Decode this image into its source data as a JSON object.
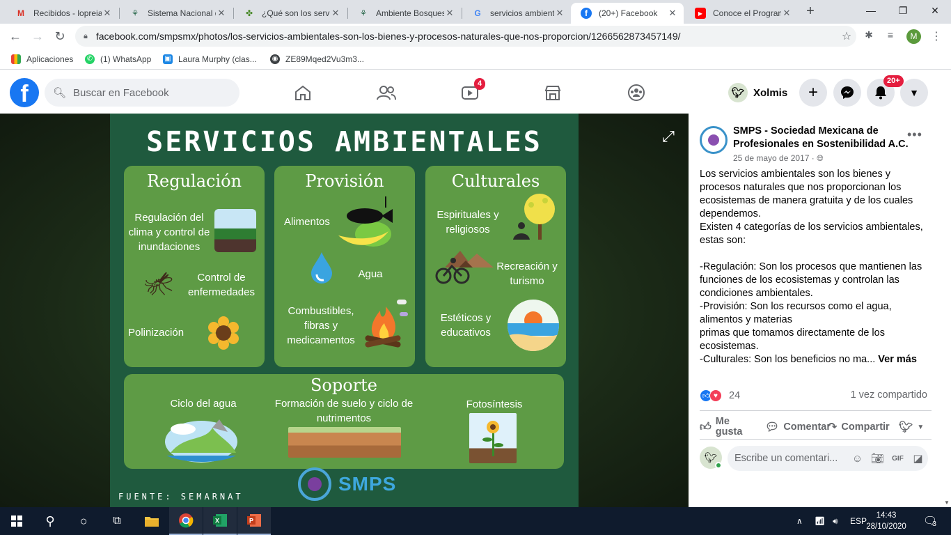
{
  "browser": {
    "tabs": [
      {
        "title": "Recibidos - lopreia",
        "icon": "gmail-icon",
        "color": "#d93025",
        "glyph": "M"
      },
      {
        "title": "Sistema Nacional de",
        "icon": "gov-seal-icon",
        "color": "#2d6b4f",
        "glyph": "⚘"
      },
      {
        "title": "¿Qué son los servic",
        "icon": "leaf-icon",
        "color": "#4a8a2a",
        "glyph": "✤"
      },
      {
        "title": "Ambiente Bosques",
        "icon": "gov-seal-icon",
        "color": "#2d6b4f",
        "glyph": "⚘"
      },
      {
        "title": "servicios ambienta",
        "icon": "google-icon",
        "color": "#4285f4",
        "glyph": "G"
      },
      {
        "title": "(20+) Facebook",
        "icon": "facebook-icon",
        "color": "#1877f2",
        "glyph": "f"
      },
      {
        "title": "Conoce el Program",
        "icon": "youtube-icon",
        "color": "#ff0000",
        "glyph": "▶"
      }
    ],
    "url": "facebook.com/smpsmx/photos/los-servicios-ambientales-son-los-bienes-y-procesos-naturales-que-nos-proporcion/1266562873457149/",
    "profile_initial": "M",
    "bookmarks": [
      {
        "label": "Aplicaciones",
        "icon": "apps-grid-icon"
      },
      {
        "label": "(1) WhatsApp",
        "icon": "whatsapp-icon"
      },
      {
        "label": "Laura Murphy (clas...",
        "icon": "classroom-icon"
      },
      {
        "label": "ZE89Mqed2Vu3m3...",
        "icon": "globe-icon"
      }
    ]
  },
  "facebook": {
    "search_placeholder": "Buscar en Facebook",
    "watch_badge": "4",
    "notifications_badge": "20+",
    "user_name": "Xolmis"
  },
  "poster": {
    "title": "SERVICIOS AMBIENTALES",
    "regulacion": {
      "heading": "Regulación",
      "item1": "Regulación del clima y control de inundaciones",
      "item2": "Control de enfermedades",
      "item3": "Polinización"
    },
    "provision": {
      "heading": "Provisión",
      "item1": "Alimentos",
      "item2": "Agua",
      "item3": "Combustibles, fibras y medicamentos"
    },
    "culturales": {
      "heading": "Culturales",
      "item1": "Espirituales y religiosos",
      "item2": "Recreación y turismo",
      "item3": "Estéticos y educativos"
    },
    "soporte": {
      "heading": "Soporte",
      "item1": "Ciclo del agua",
      "item2": "Formación de suelo y ciclo de nutrimentos",
      "item3": "Fotosíntesis"
    },
    "source": "FUENTE: SEMARNAT",
    "logo_text": "SMPS"
  },
  "post": {
    "author": "SMPS - Sociedad Mexicana de Profesionales en Sostenibilidad A.C.",
    "date": "25 de mayo de 2017 · ",
    "body": [
      "Los servicios ambientales son los bienes y procesos naturales que nos proporcionan los ecosistemas de manera gratuita y de los cuales dependemos.",
      "Existen 4 categorías de los servicios ambientales, estas son:",
      "",
      "-Regulación: Son los procesos que mantienen las funciones de los ecosistemas y controlan las condiciones ambientales.",
      "-Provisión: Son los recursos como el agua, alimentos y materias",
      "primas que tomamos directamente de los ecosistemas.",
      "-Culturales: Son los beneficios no ma..."
    ],
    "see_more": "Ver más",
    "reaction_count": "24",
    "shares": "1 vez compartido",
    "like_label": "Me gusta",
    "comment_label": "Comentar",
    "share_label": "Compartir",
    "comment_placeholder": "Escribe un comentari..."
  },
  "taskbar": {
    "lang": "ESP",
    "time": "14:43",
    "date": "28/10/2020",
    "notif_count": "3"
  }
}
